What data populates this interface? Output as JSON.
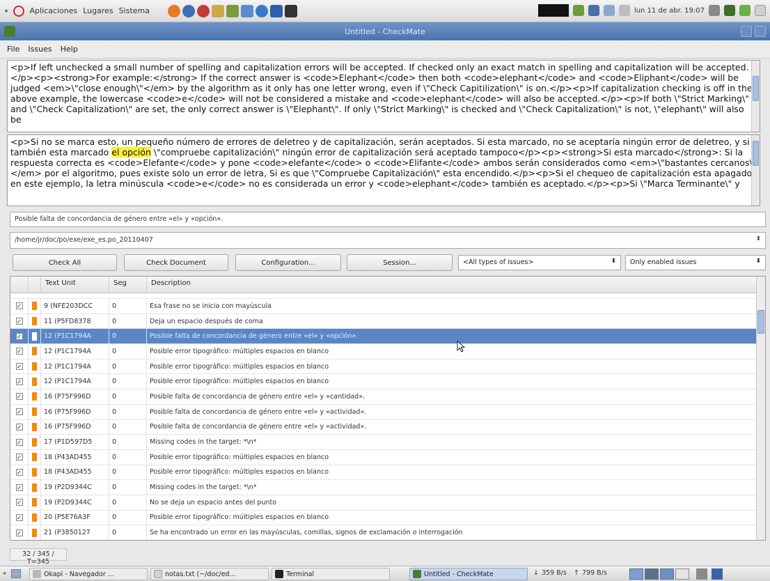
{
  "colors": {
    "accent": "#5a86c6",
    "issue_marker": "#f58a07",
    "highlight": "#ffee33"
  },
  "top_panel": {
    "menus": [
      "Aplicaciones",
      "Lugares",
      "Sistema"
    ],
    "clock": "lun 11 de abr. 19:07"
  },
  "window": {
    "title": "Untitled - CheckMate"
  },
  "menubar": {
    "items": [
      "File",
      "Issues",
      "Help"
    ]
  },
  "source_text": "<p>If left unchecked a small number of spelling and capitalization errors will be accepted. If checked only an exact match in spelling and capitalization will be accepted.</p><p><strong>For example:</strong> If the correct answer is <code>Elephant</code> then both <code>elephant</code> and <code>Eliphant</code> will be judged <em>\\\"close enough\\\"</em> by the algorithm as it only has one letter wrong, even if \\\"Check Capitilization\\\" is on.</p><p>If capitalization checking is off in the above example, the lowercase <code>e</code> will not be considered a mistake and <code>elephant</code> will also be accepted.</p><p>If both \\\"Strict Marking\\\" and \\\"Check Capitalization\\\" are set, the only correct answer is \\\"Elephant\\\". If only \\\"Strict Marking\\\" is checked and \\\"Check Capitalization\\\" is not, \\\"elephant\\\" will also be",
  "target_text": {
    "before": "<p>Si no se marca esto, un pequeño número de errores de deletreo y de capitalización, serán aceptados. Si esta marcado, no se aceptaría ningún error de deletreo, y si también esta marcado ",
    "highlight": "el opción",
    "after": " \\\"compruebe capitalización\\\" ningún error de capitalización será aceptado tampoco</p><p><strong>Si esta marcado</strong>: Si la respuesta correcta es <code>Elefante</code> y pone <code>elefante</code> o <code>Elifante</code> ambos serán considerados como <em>\\\"bastantes cercanos\\\"</em> por el algoritmo, pues existe solo un error de letra, Si  es que  \\\"Compruebe Capitalización\\\" esta encendido.</p><p>Si el chequeo de capitalización esta apagado en este ejemplo, la letra minúscula <code>e</code> no es considerada un error y <code>elephant</code> también es aceptado.</p><p>Si \\\"Marca Terminante\\\" y"
  },
  "issue_message": "Posible falta de concordancia de género entre «el» y «opción».",
  "file_path": "/home/jr/doc/po/exe/exe_es.po_20110407",
  "buttons": {
    "check_all": "Check All",
    "check_document": "Check Document",
    "configuration": "Configuration...",
    "session": "Session..."
  },
  "filters": {
    "issue_types": "<All types of issues>",
    "enabled": "Only enabled issues"
  },
  "table": {
    "columns": [
      "Text Unit",
      "Seg",
      "Description"
    ],
    "rows": [
      {
        "unit": "9 (NFE203DCC",
        "seg": "0",
        "desc": "Esa frase no se inicia con mayúscula",
        "selected": false
      },
      {
        "unit": "11 (P5FD8378",
        "seg": "0",
        "desc": "Deja un espacio después de coma",
        "selected": false
      },
      {
        "unit": "12 (P1C1794A",
        "seg": "0",
        "desc": "Posible falta de concordancia de género entre «el» y «opción».",
        "selected": true
      },
      {
        "unit": "12 (P1C1794A",
        "seg": "0",
        "desc": "Posible error tipográfico: múltiples espacios en blanco",
        "selected": false
      },
      {
        "unit": "12 (P1C1794A",
        "seg": "0",
        "desc": "Posible error tipográfico: múltiples espacios en blanco",
        "selected": false
      },
      {
        "unit": "12 (P1C1794A",
        "seg": "0",
        "desc": "Posible error tipográfico: múltiples espacios en blanco",
        "selected": false
      },
      {
        "unit": "16 (P75F996D",
        "seg": "0",
        "desc": "Posible falta de concordancia de género entre «el» y «cantidad».",
        "selected": false
      },
      {
        "unit": "16 (P75F996D",
        "seg": "0",
        "desc": "Posible falta de concordancia de género entre «el» y «actividad».",
        "selected": false
      },
      {
        "unit": "16 (P75F996D",
        "seg": "0",
        "desc": "Posible falta de concordancia de género entre «el» y «actividad».",
        "selected": false
      },
      {
        "unit": "17 (P1D597D5",
        "seg": "0",
        "desc": "Missing codes in the target: *\\n*",
        "selected": false
      },
      {
        "unit": "18 (P43AD455",
        "seg": "0",
        "desc": "Posible error tipográfico: múltiples espacios en blanco",
        "selected": false
      },
      {
        "unit": "18 (P43AD455",
        "seg": "0",
        "desc": "Posible error tipográfico: múltiples espacios en blanco",
        "selected": false
      },
      {
        "unit": "19 (P2D9344C",
        "seg": "0",
        "desc": "Missing codes in the target: *\\n*",
        "selected": false
      },
      {
        "unit": "19 (P2D9344C",
        "seg": "0",
        "desc": "No se deja un espacio antes del punto",
        "selected": false
      },
      {
        "unit": "20 (P5E76A3F",
        "seg": "0",
        "desc": "Posible error tipográfico: múltiples espacios en blanco",
        "selected": false
      },
      {
        "unit": "21 (P3850127",
        "seg": "0",
        "desc": "Se ha encontrado un error en las mayúsculas, comillas, signos de exclamación o interrogación",
        "selected": false
      }
    ]
  },
  "status": {
    "count": "32 / 345 / T=345"
  },
  "taskbar": {
    "tasks": [
      "Okapi - Navegador ...",
      "notas.txt (~/doc/ed...",
      "Terminal",
      "Untitled - CheckMate"
    ],
    "net_down": "359 B/s",
    "net_up": "799 B/s"
  }
}
